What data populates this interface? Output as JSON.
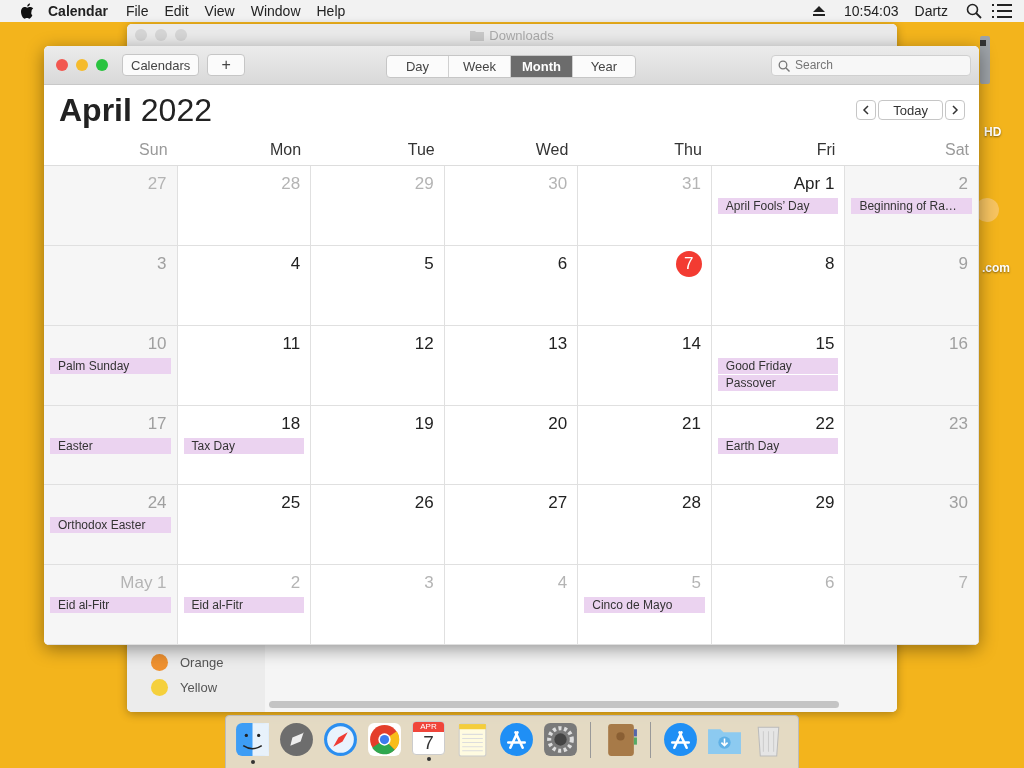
{
  "menu_bar": {
    "app": "Calendar",
    "items": [
      "File",
      "Edit",
      "View",
      "Window",
      "Help"
    ],
    "clock": "10:54:03",
    "user": "Dartz"
  },
  "desktop_icons": [
    {
      "kind": "disk",
      "label": "HD"
    },
    {
      "kind": "doc",
      "label": ".com"
    }
  ],
  "finder_window": {
    "title": "Downloads",
    "tags": [
      {
        "label": "Orange",
        "color": "#ef9130"
      },
      {
        "label": "Yellow",
        "color": "#f5d03c"
      }
    ]
  },
  "calendar_window": {
    "toolbar": {
      "calendars_button": "Calendars",
      "add_button": "+",
      "views": [
        {
          "label": "Day",
          "selected": false
        },
        {
          "label": "Week",
          "selected": false
        },
        {
          "label": "Month",
          "selected": true
        },
        {
          "label": "Year",
          "selected": false
        }
      ],
      "search": {
        "placeholder": "Search"
      }
    },
    "month": "April",
    "year": "2022",
    "today_button": "Today",
    "weekdays": [
      "Sun",
      "Mon",
      "Tue",
      "Wed",
      "Thu",
      "Fri",
      "Sat"
    ],
    "weeks": [
      [
        {
          "label": "27",
          "muted": true,
          "today": false
        },
        {
          "label": "28",
          "muted": true,
          "today": false
        },
        {
          "label": "29",
          "muted": true,
          "today": false
        },
        {
          "label": "30",
          "muted": true,
          "today": false
        },
        {
          "label": "31",
          "muted": true,
          "today": false
        },
        {
          "label": "Apr 1",
          "muted": false,
          "today": false,
          "events": [
            "April Fools’ Day"
          ]
        },
        {
          "label": "2",
          "muted": false,
          "today": false,
          "events": [
            "Beginning of Ra…"
          ]
        }
      ],
      [
        {
          "label": "3",
          "muted": false,
          "today": false
        },
        {
          "label": "4",
          "muted": false,
          "today": false
        },
        {
          "label": "5",
          "muted": false,
          "today": false
        },
        {
          "label": "6",
          "muted": false,
          "today": false
        },
        {
          "label": "7",
          "today": true
        },
        {
          "label": "8",
          "muted": false,
          "today": false
        },
        {
          "label": "9",
          "muted": false,
          "today": false
        }
      ],
      [
        {
          "label": "10",
          "muted": false,
          "today": false,
          "events": [
            "Palm Sunday"
          ]
        },
        {
          "label": "11",
          "muted": false,
          "today": false
        },
        {
          "label": "12",
          "muted": false,
          "today": false
        },
        {
          "label": "13",
          "muted": false,
          "today": false
        },
        {
          "label": "14",
          "muted": false,
          "today": false
        },
        {
          "label": "15",
          "muted": false,
          "today": false,
          "events": [
            "Good Friday",
            "Passover"
          ]
        },
        {
          "label": "16",
          "muted": false,
          "today": false
        }
      ],
      [
        {
          "label": "17",
          "muted": false,
          "today": false,
          "events": [
            "Easter"
          ]
        },
        {
          "label": "18",
          "muted": false,
          "today": false,
          "events": [
            "Tax Day"
          ]
        },
        {
          "label": "19",
          "muted": false,
          "today": false
        },
        {
          "label": "20",
          "muted": false,
          "today": false
        },
        {
          "label": "21",
          "muted": false,
          "today": false
        },
        {
          "label": "22",
          "muted": false,
          "today": false,
          "events": [
            "Earth Day"
          ]
        },
        {
          "label": "23",
          "muted": false,
          "today": false
        }
      ],
      [
        {
          "label": "24",
          "muted": false,
          "today": false,
          "events": [
            "Orthodox Easter"
          ]
        },
        {
          "label": "25",
          "muted": false,
          "today": false
        },
        {
          "label": "26",
          "muted": false,
          "today": false
        },
        {
          "label": "27",
          "muted": false,
          "today": false
        },
        {
          "label": "28",
          "muted": false,
          "today": false
        },
        {
          "label": "29",
          "muted": false,
          "today": false
        },
        {
          "label": "30",
          "muted": false,
          "today": false
        }
      ],
      [
        {
          "label": "May 1",
          "muted": true,
          "today": false,
          "events": [
            "Eid al-Fitr"
          ]
        },
        {
          "label": "2",
          "muted": true,
          "today": false,
          "events": [
            "Eid al-Fitr"
          ]
        },
        {
          "label": "3",
          "muted": true,
          "today": false
        },
        {
          "label": "4",
          "muted": true,
          "today": false
        },
        {
          "label": "5",
          "muted": true,
          "today": false,
          "events": [
            "Cinco de Mayo"
          ]
        },
        {
          "label": "6",
          "muted": true,
          "today": false
        },
        {
          "label": "7",
          "muted": true,
          "today": false
        }
      ]
    ]
  },
  "dock": [
    {
      "kind": "finder",
      "running": true
    },
    {
      "kind": "launchpad"
    },
    {
      "kind": "safari"
    },
    {
      "kind": "chrome"
    },
    {
      "kind": "calendar",
      "running": true,
      "month": "APR",
      "day": "7"
    },
    {
      "kind": "notes"
    },
    {
      "kind": "appstore"
    },
    {
      "kind": "settings"
    },
    {
      "kind": "separator"
    },
    {
      "kind": "contacts"
    },
    {
      "kind": "separator"
    },
    {
      "kind": "appstore2"
    },
    {
      "kind": "downloads"
    },
    {
      "kind": "trash"
    }
  ]
}
